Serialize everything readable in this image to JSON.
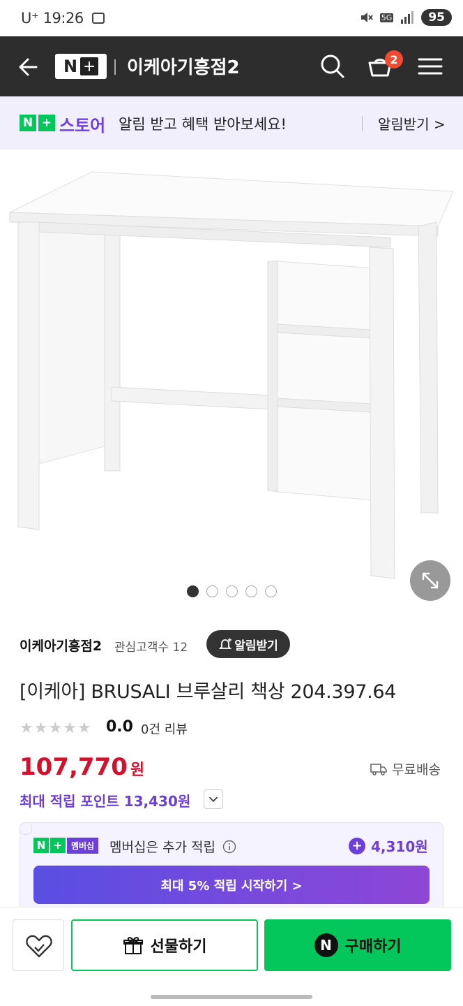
{
  "status_bar": {
    "carrier": "U⁺",
    "time": "19:26",
    "network": "5G",
    "battery": "95"
  },
  "header": {
    "title": "이케아기흥점2",
    "cart_count": "2",
    "logo_n": "N"
  },
  "banner": {
    "store_label": "스토어",
    "message": "알림 받고 혜택 받아보세요!",
    "alarm_button": "알림받기 >"
  },
  "gallery": {
    "image_alt": "BRUSALI white desk",
    "total_images": 5,
    "current_index": 1
  },
  "seller": {
    "name": "이케아기흥점2",
    "fans": "관심고객수 12",
    "alarm_button": "알림받기"
  },
  "product": {
    "title": "[이케아] BRUSALI 브루살리 책상 204.397.64",
    "rating": "0.0",
    "review_count": "0건 리뷰",
    "star_count": 5,
    "price": "107,770",
    "currency": "원",
    "shipping": "무료배송",
    "max_points": "최대 적립 포인트 13,430원"
  },
  "membership": {
    "label": "멤버십",
    "text": "멤버십은 추가 적립",
    "amount": "4,310원",
    "cta": "최대 5% 적립 시작하기 >"
  },
  "bottom_bar": {
    "gift": "선물하기",
    "buy": "구매하기"
  },
  "colors": {
    "accent_green": "#03c75a",
    "brand_purple": "#6b3fd8",
    "price_red": "#d6102c",
    "header_bg": "#2d2d2d"
  }
}
